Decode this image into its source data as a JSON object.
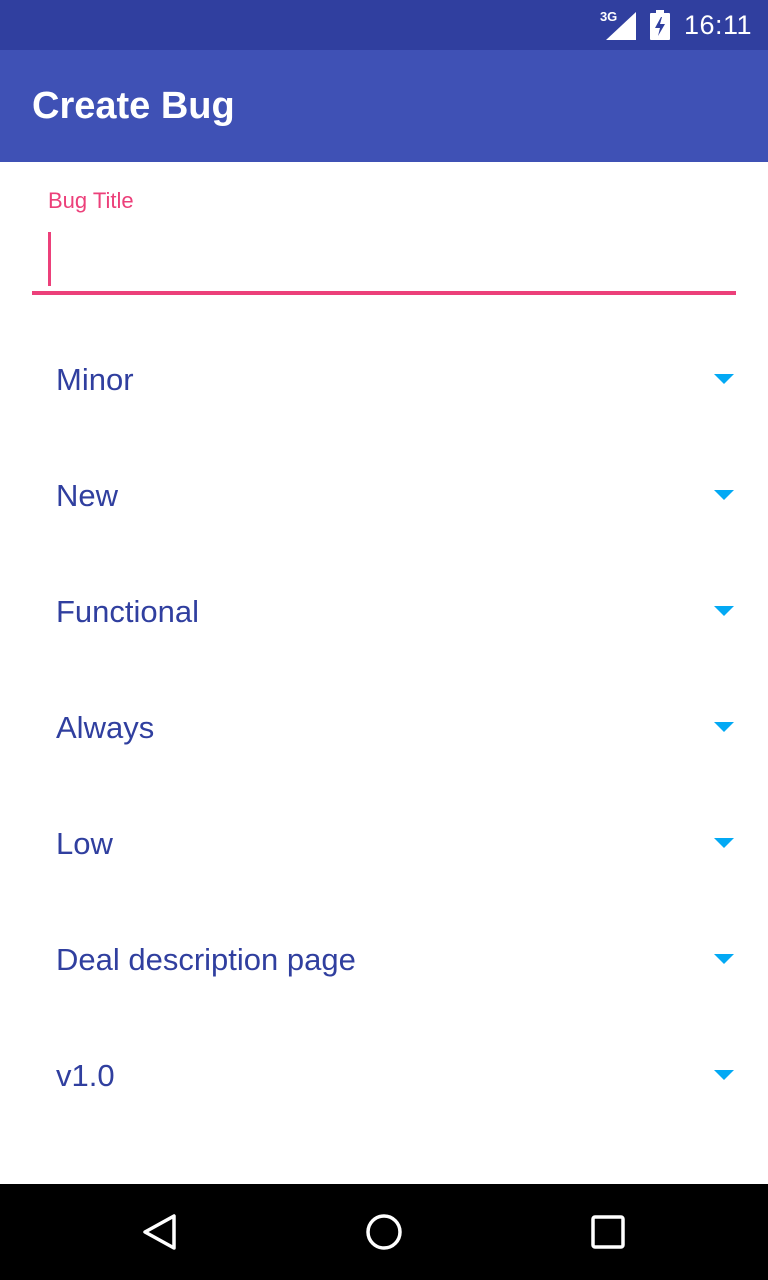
{
  "status_bar": {
    "network": "3G",
    "time": "16:11",
    "icons": [
      "signal-icon",
      "battery-charging-icon"
    ]
  },
  "app_bar": {
    "title": "Create Bug"
  },
  "form": {
    "title_field": {
      "label": "Bug Title",
      "value": ""
    },
    "spinners": [
      {
        "value": "Minor"
      },
      {
        "value": "New"
      },
      {
        "value": "Functional"
      },
      {
        "value": "Always"
      },
      {
        "value": "Low"
      },
      {
        "value": "Deal description page"
      },
      {
        "value": "v1.0"
      }
    ]
  },
  "nav_bar": {
    "icons": [
      "back-icon",
      "home-icon",
      "recents-icon"
    ]
  },
  "colors": {
    "status_bar": "#303f9f",
    "app_bar": "#3f51b5",
    "accent": "#ec407a",
    "spinner_text": "#303f9f",
    "spinner_caret": "#03a9f4"
  }
}
